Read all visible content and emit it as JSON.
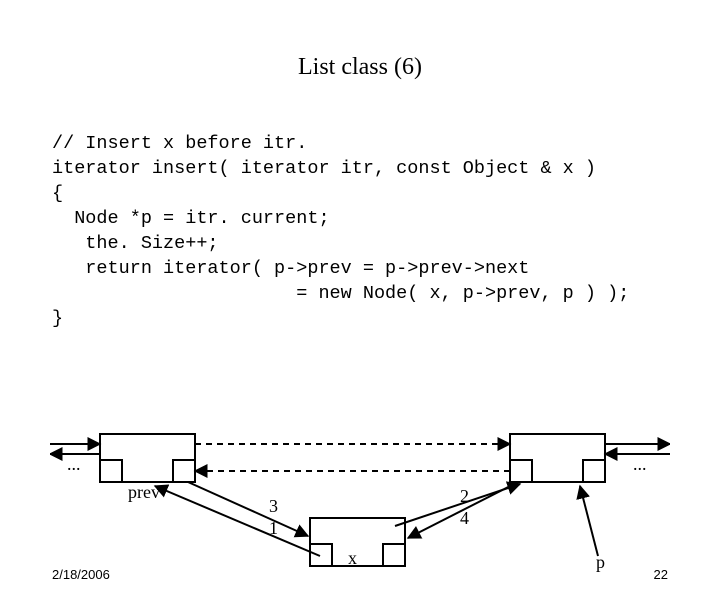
{
  "title": "List class (6)",
  "code_lines": [
    "// Insert x before itr.",
    "iterator insert( iterator itr, const Object & x )",
    "{",
    "  Node *p = itr. current;",
    "   the. Size++;",
    "   return iterator( p->prev = p->prev->next",
    "                      = new Node( x, p->prev, p ) );",
    "}"
  ],
  "diagram": {
    "dots_left": "...",
    "dots_right": "...",
    "label_prev": "prev",
    "label_x": "x",
    "label_p": "p",
    "num_1": "1",
    "num_2": "2",
    "num_3": "3",
    "num_4": "4"
  },
  "footer": {
    "date": "2/18/2006",
    "page": "22"
  }
}
